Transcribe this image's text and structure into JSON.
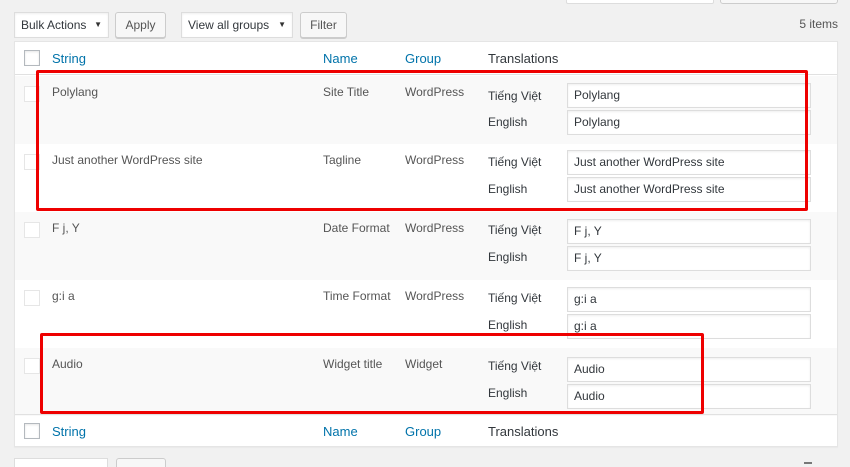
{
  "tablenav": {
    "bulk_actions": "Bulk Actions",
    "apply": "Apply",
    "groups_filter": "View all groups",
    "filter": "Filter",
    "items_count": "5 items"
  },
  "columns": {
    "string": "String",
    "name": "Name",
    "group": "Group",
    "translations": "Translations"
  },
  "rows": [
    {
      "string": "Polylang",
      "name": "Site Title",
      "group": "WordPress",
      "translations": [
        {
          "language": "Tiếng Việt",
          "value": "Polylang"
        },
        {
          "language": "English",
          "value": "Polylang"
        }
      ]
    },
    {
      "string": "Just another WordPress site",
      "name": "Tagline",
      "group": "WordPress",
      "translations": [
        {
          "language": "Tiếng Việt",
          "value": "Just another WordPress site"
        },
        {
          "language": "English",
          "value": "Just another WordPress site"
        }
      ]
    },
    {
      "string": "F j, Y",
      "name": "Date Format",
      "group": "WordPress",
      "translations": [
        {
          "language": "Tiếng Việt",
          "value": "F j, Y"
        },
        {
          "language": "English",
          "value": "F j, Y"
        }
      ]
    },
    {
      "string": "g:i a",
      "name": "Time Format",
      "group": "WordPress",
      "translations": [
        {
          "language": "Tiếng Việt",
          "value": "g:i a"
        },
        {
          "language": "English",
          "value": "g:i a"
        }
      ]
    },
    {
      "string": "Audio",
      "name": "Widget title",
      "group": "Widget",
      "translations": [
        {
          "language": "Tiếng Việt",
          "value": "Audio"
        },
        {
          "language": "English",
          "value": "Audio"
        }
      ]
    }
  ],
  "colors": {
    "link": "#0073aa",
    "highlight": "#ee0000",
    "background": "#f1f1f1"
  }
}
